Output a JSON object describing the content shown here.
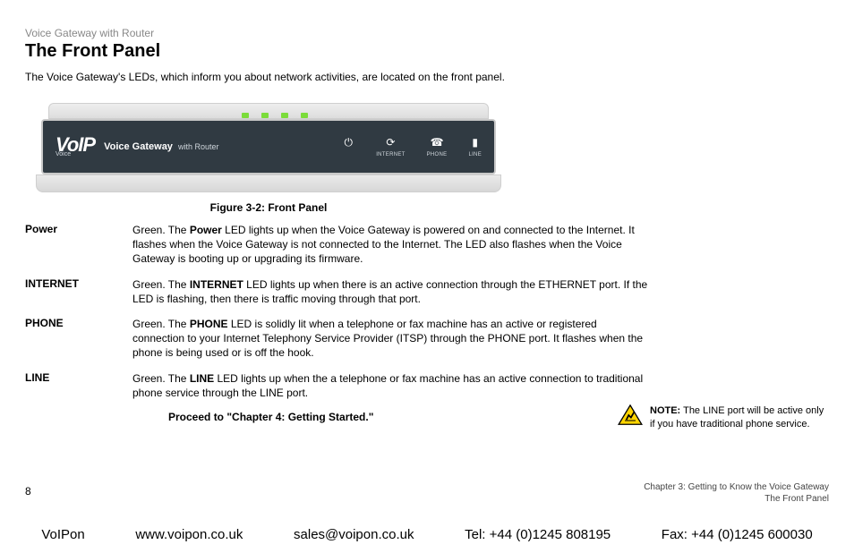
{
  "header": {
    "breadcrumb": "Voice Gateway with Router",
    "title": "The Front Panel",
    "intro": "The Voice Gateway's LEDs, which inform you about network activities, are located on the front panel."
  },
  "figure": {
    "caption": "Figure 3-2: Front Panel",
    "device": {
      "logo_main": "VoIP",
      "logo_sub": "Voice",
      "tagline_bold": "Voice Gateway",
      "tagline_rest": "with Router",
      "icons": [
        {
          "name": "power-icon",
          "glyph": "⏻",
          "label": ""
        },
        {
          "name": "internet-icon",
          "glyph": "⟳",
          "label": "INTERNET"
        },
        {
          "name": "phone-icon",
          "glyph": "☎",
          "label": "PHONE"
        },
        {
          "name": "line-icon",
          "glyph": "▮",
          "label": "LINE"
        }
      ]
    }
  },
  "definitions": [
    {
      "term": "Power",
      "color": "Green. ",
      "bold": "Power",
      "text_before_bold": "The ",
      "text_after_bold": " LED lights up when the Voice Gateway is powered on and connected to the Internet. It flashes when the Voice Gateway is not connected to the Internet. The LED also flashes when the Voice Gateway is booting up or upgrading its firmware."
    },
    {
      "term": "INTERNET",
      "color": "Green. ",
      "bold": "INTERNET",
      "text_before_bold": "The ",
      "text_after_bold": " LED lights up when there is an active connection through the ETHERNET port. If the LED is flashing, then there is traffic moving through that port."
    },
    {
      "term": "PHONE",
      "color": "Green. ",
      "bold": "PHONE",
      "text_before_bold": "The ",
      "text_after_bold": " LED is solidly lit when a telephone or fax machine has an active or registered connection to your Internet Telephony Service Provider (ITSP) through the PHONE port. It flashes when the phone is being used or is off the hook."
    },
    {
      "term": "LINE",
      "color": "Green. ",
      "bold": "LINE",
      "text_before_bold": "The ",
      "text_after_bold": " LED lights up when the a telephone or fax machine has an active connection to traditional phone service through the LINE port."
    }
  ],
  "proceed": "Proceed to \"Chapter 4: Getting Started.\"",
  "note": {
    "label": "NOTE:",
    "text": "The LINE port will be active only if you have traditional phone service."
  },
  "page_meta": {
    "page_number": "8",
    "chapter_line1": "Chapter 3: Getting to Know the Voice Gateway",
    "chapter_line2": "The Front Panel"
  },
  "footer": {
    "company": "VoIPon",
    "website": "www.voipon.co.uk",
    "email": "sales@voipon.co.uk",
    "tel": "Tel: +44 (0)1245 808195",
    "fax": "Fax: +44 (0)1245 600030"
  }
}
